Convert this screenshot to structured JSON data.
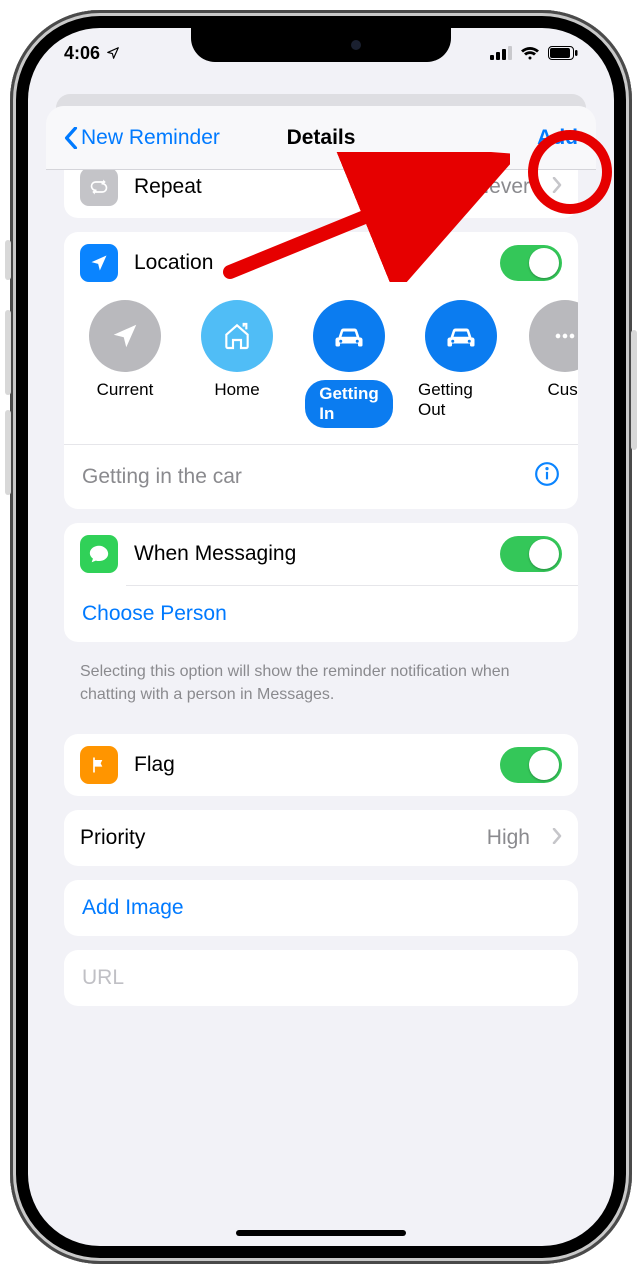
{
  "status": {
    "time": "4:06"
  },
  "nav": {
    "back_label": "New Reminder",
    "title": "Details",
    "add_label": "Add"
  },
  "repeat": {
    "label": "Repeat",
    "value": "Never"
  },
  "location": {
    "label": "Location",
    "options": [
      {
        "id": "current",
        "label": "Current"
      },
      {
        "id": "home",
        "label": "Home"
      },
      {
        "id": "getting-in",
        "label": "Getting In"
      },
      {
        "id": "getting-out",
        "label": "Getting Out"
      },
      {
        "id": "custom",
        "label": "Cust"
      }
    ],
    "description": "Getting in the car"
  },
  "messaging": {
    "label": "When Messaging",
    "choose_label": "Choose Person",
    "footer": "Selecting this option will show the reminder notification when chatting with a person in Messages."
  },
  "flag": {
    "label": "Flag"
  },
  "priority": {
    "label": "Priority",
    "value": "High"
  },
  "add_image": {
    "label": "Add Image"
  },
  "url": {
    "placeholder": "URL"
  }
}
